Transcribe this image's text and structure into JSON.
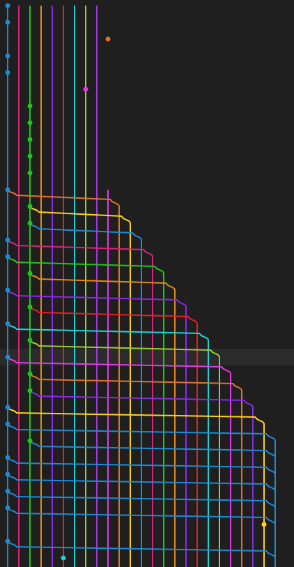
{
  "view": {
    "name": "git-commit-graph",
    "selected_row_index": 21
  },
  "lane_colors": [
    "#1f8ad2",
    "#d6257c",
    "#20c61a",
    "#e18a1f",
    "#8a2be2",
    "#e32222",
    "#19d6d6",
    "#9acd32",
    "#9f3ad6",
    "#e13ae6",
    "#e0732f",
    "#ffd21f",
    "#1f8ad2",
    "#d6257c",
    "#20c61a",
    "#e18a1f",
    "#8a2be2",
    "#e32222",
    "#19d6d6",
    "#9acd32",
    "#e13ae6",
    "#e0732f",
    "#8a2be2",
    "#ffd21f",
    "#1f8ad2"
  ],
  "graph": {
    "initial_lanes": [
      0,
      1,
      2,
      3,
      4,
      5,
      6,
      7
    ],
    "top_lanes": [
      0,
      1,
      2,
      3,
      4,
      5,
      6,
      7,
      8
    ],
    "commits": [
      {
        "lane": 0,
        "color": "#1f8ad2"
      },
      {
        "lane": 0,
        "color": "#1f8ad2",
        "branches": [
          {
            "lane": 9,
            "color": "#e0732f"
          }
        ]
      },
      {
        "lane": 9,
        "color": "#e0732f",
        "merge_into": 0,
        "merges": [
          {
            "lane": 10,
            "color": "#1f8ad2"
          }
        ]
      },
      {
        "lane": 0,
        "color": "#1f8ad2"
      },
      {
        "lane": 0,
        "color": "#1f8ad2",
        "branches": [
          {
            "lane": 9,
            "color": "#8a2be2"
          }
        ]
      },
      {
        "lane": 7,
        "color": "#e13ae6",
        "branches": [
          {
            "lane": 10,
            "color": "#20c61a"
          }
        ]
      },
      {
        "lane": 2,
        "color": "#20c61a",
        "branches": [
          {
            "lane": 8,
            "color": "#e13ae6"
          }
        ]
      },
      {
        "lane": 2,
        "color": "#20c61a"
      },
      {
        "lane": 2,
        "color": "#20c61a"
      },
      {
        "lane": 2,
        "color": "#20c61a"
      },
      {
        "lane": 2,
        "color": "#20c61a"
      },
      {
        "lane": 0,
        "color": "#1f8ad2"
      },
      {
        "lane": 2,
        "color": "#20c61a"
      },
      {
        "lane": 2,
        "color": "#20c61a"
      },
      {
        "lane": 0,
        "color": "#1f8ad2"
      },
      {
        "lane": 0,
        "color": "#1f8ad2"
      },
      {
        "lane": 2,
        "color": "#20c61a"
      },
      {
        "lane": 0,
        "color": "#1f8ad2"
      },
      {
        "lane": 2,
        "color": "#20c61a"
      },
      {
        "lane": 0,
        "color": "#1f8ad2"
      },
      {
        "lane": 2,
        "color": "#20c61a"
      },
      {
        "lane": 0,
        "color": "#1f8ad2"
      },
      {
        "lane": 2,
        "color": "#20c61a"
      },
      {
        "lane": 2,
        "color": "#20c61a"
      },
      {
        "lane": 0,
        "color": "#1f8ad2"
      },
      {
        "lane": 0,
        "color": "#1f8ad2"
      },
      {
        "lane": 2,
        "color": "#20c61a"
      },
      {
        "lane": 0,
        "color": "#1f8ad2"
      },
      {
        "lane": 0,
        "color": "#1f8ad2"
      },
      {
        "lane": 0,
        "color": "#1f8ad2"
      },
      {
        "lane": 0,
        "color": "#1f8ad2"
      },
      {
        "lane": 23,
        "color": "#ffd21f"
      },
      {
        "lane": 0,
        "color": "#1f8ad2"
      },
      {
        "lane": 5,
        "color": "#19d6d6"
      }
    ]
  }
}
